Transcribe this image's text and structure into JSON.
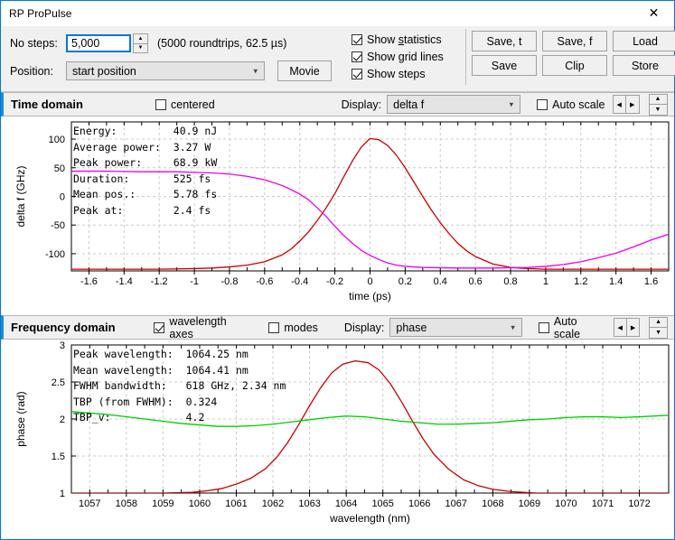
{
  "window": {
    "title": "RP ProPulse",
    "close_icon": "close-icon"
  },
  "controls": {
    "no_steps_label": "No steps:",
    "no_steps_value": "5,000",
    "roundtrips_hint": "(5000 roundtrips, 62.5 µs)",
    "position_label": "Position:",
    "position_value": "start position",
    "movie_button": "Movie",
    "checkboxes": [
      {
        "label_pre": "Show ",
        "label_accel": "s",
        "label_post": "tatistics",
        "checked": true,
        "name": "show-statistics"
      },
      {
        "label_pre": "Show ",
        "label_accel": "g",
        "label_post": "rid lines",
        "checked": true,
        "name": "show-grid-lines"
      },
      {
        "label_pre": "Show steps",
        "label_accel": "",
        "label_post": "",
        "checked": true,
        "name": "show-steps"
      }
    ],
    "buttons": [
      "Save, t",
      "Save, f",
      "Load",
      "Save",
      "Clip",
      "Store"
    ]
  },
  "time_domain": {
    "title": "Time domain",
    "centered_label": "centered",
    "centered_checked": false,
    "display_label": "Display:",
    "display_value": "delta f",
    "autoscale_label": "Auto scale",
    "autoscale_checked": false,
    "stats": [
      {
        "key": "Energy:",
        "value": "40.9 nJ"
      },
      {
        "key": "Average power:",
        "value": "3.27 W"
      },
      {
        "key": "Peak power:",
        "value": "68.9 kW"
      },
      {
        "key": "Duration:",
        "value": "525 fs"
      },
      {
        "key": "Mean pos.:",
        "value": "5.78 fs"
      },
      {
        "key": "Peak at:",
        "value": "2.4 fs"
      }
    ]
  },
  "frequency_domain": {
    "title": "Frequency domain",
    "wavelength_axes_label": "wavelength axes",
    "wavelength_axes_checked": true,
    "modes_label": "modes",
    "modes_checked": false,
    "display_label": "Display:",
    "display_value": "phase",
    "autoscale_label": "Auto scale",
    "autoscale_checked": false,
    "stats": [
      {
        "key": "Peak wavelength:",
        "value": "1064.25 nm"
      },
      {
        "key": "Mean wavelength:",
        "value": "1064.41 nm"
      },
      {
        "key": "FWHM bandwidth:",
        "value": "618 GHz, 2.34 nm"
      },
      {
        "key": "TBP (from FWHM):",
        "value": "0.324"
      },
      {
        "key": "TBP_v:",
        "value": "4.2"
      }
    ]
  },
  "colors": {
    "accent": "#1f8ad2",
    "pulse_red": "#cc0000",
    "chirp_magenta": "#ee00ee",
    "phase_green": "#00cc00",
    "grid": "#cccccc",
    "panel": "#f0f0f0"
  },
  "chart_data": [
    {
      "type": "line",
      "id": "time-domain-plot",
      "title": "",
      "xlabel": "time (ps)",
      "ylabel": "delta f (GHz)",
      "xlim": [
        -1.7,
        1.7
      ],
      "ylim": [
        -130,
        130
      ],
      "xticks": [
        -1.6,
        -1.4,
        -1.2,
        -1,
        -0.8,
        -0.6,
        -0.4,
        -0.2,
        0,
        0.2,
        0.4,
        0.6,
        0.8,
        1,
        1.2,
        1.4,
        1.6
      ],
      "yticks": [
        100,
        50,
        0,
        -50,
        -100
      ],
      "grid": true,
      "series": [
        {
          "name": "power (red pulse)",
          "color": "#cc0000",
          "x": [
            -1.7,
            -1.2,
            -1.0,
            -0.9,
            -0.8,
            -0.7,
            -0.6,
            -0.5,
            -0.45,
            -0.4,
            -0.35,
            -0.3,
            -0.25,
            -0.2,
            -0.15,
            -0.1,
            -0.05,
            0.0,
            0.05,
            0.1,
            0.15,
            0.2,
            0.25,
            0.3,
            0.35,
            0.4,
            0.45,
            0.5,
            0.55,
            0.6,
            0.7,
            0.8,
            0.9,
            1.0,
            1.3,
            1.7
          ],
          "y": [
            -127,
            -127,
            -126,
            -125,
            -123,
            -120,
            -114,
            -102,
            -92,
            -78,
            -62,
            -42,
            -20,
            5,
            34,
            62,
            86,
            101,
            99,
            89,
            72,
            50,
            25,
            0,
            -24,
            -46,
            -65,
            -82,
            -95,
            -105,
            -118,
            -124,
            -126,
            -127,
            -127,
            -127
          ]
        },
        {
          "name": "instantaneous frequency (magenta chirp)",
          "color": "#ee00ee",
          "x": [
            -1.7,
            -1.5,
            -1.3,
            -1.1,
            -1.0,
            -0.9,
            -0.8,
            -0.7,
            -0.6,
            -0.5,
            -0.45,
            -0.4,
            -0.35,
            -0.3,
            -0.25,
            -0.2,
            -0.15,
            -0.1,
            -0.05,
            0.0,
            0.05,
            0.1,
            0.15,
            0.2,
            0.3,
            0.5,
            0.7,
            0.9,
            1.0,
            1.1,
            1.2,
            1.3,
            1.4,
            1.5,
            1.6,
            1.7
          ],
          "y": [
            44,
            44,
            43,
            43,
            42,
            41,
            39,
            35,
            29,
            19,
            12,
            4,
            -6,
            -20,
            -35,
            -52,
            -68,
            -82,
            -94,
            -103,
            -110,
            -116,
            -120,
            -122,
            -124,
            -125,
            -125,
            -124,
            -122,
            -119,
            -114,
            -107,
            -99,
            -88,
            -76,
            -66
          ]
        }
      ]
    },
    {
      "type": "line",
      "id": "frequency-domain-plot",
      "title": "",
      "xlabel": "wavelength (nm)",
      "ylabel": "phase (rad)",
      "xlim": [
        1056.5,
        1072.8
      ],
      "ylim": [
        1.0,
        3.0
      ],
      "xticks": [
        1057,
        1058,
        1059,
        1060,
        1061,
        1062,
        1063,
        1064,
        1065,
        1066,
        1067,
        1068,
        1069,
        1070,
        1071,
        1072
      ],
      "yticks": [
        3,
        2.5,
        2,
        1.5,
        1
      ],
      "grid": true,
      "series": [
        {
          "name": "spectrum (red)",
          "color": "#cc0000",
          "x": [
            1056.5,
            1059.0,
            1059.8,
            1060.2,
            1060.6,
            1061.0,
            1061.4,
            1061.8,
            1062.1,
            1062.4,
            1062.7,
            1063.0,
            1063.3,
            1063.6,
            1063.9,
            1064.25,
            1064.6,
            1064.9,
            1065.2,
            1065.5,
            1065.8,
            1066.1,
            1066.4,
            1066.8,
            1067.2,
            1067.6,
            1068.0,
            1068.5,
            1069.2,
            1070.5,
            1072.8
          ],
          "y": [
            1.0,
            1.0,
            1.01,
            1.03,
            1.06,
            1.12,
            1.2,
            1.33,
            1.48,
            1.68,
            1.92,
            2.18,
            2.42,
            2.62,
            2.74,
            2.785,
            2.76,
            2.66,
            2.48,
            2.24,
            1.98,
            1.73,
            1.52,
            1.32,
            1.18,
            1.1,
            1.05,
            1.02,
            1.0,
            1.0,
            1.0
          ]
        },
        {
          "name": "phase (green)",
          "color": "#00cc00",
          "x": [
            1056.5,
            1057.0,
            1057.5,
            1058.0,
            1058.5,
            1059.0,
            1059.5,
            1060.0,
            1060.5,
            1061.0,
            1061.5,
            1062.0,
            1062.5,
            1063.0,
            1063.5,
            1064.0,
            1064.5,
            1065.0,
            1065.5,
            1066.0,
            1066.5,
            1067.0,
            1067.5,
            1068.0,
            1068.5,
            1069.0,
            1069.5,
            1070.0,
            1070.5,
            1071.0,
            1071.5,
            1072.0,
            1072.8
          ],
          "y": [
            2.1,
            2.08,
            2.06,
            2.03,
            2.0,
            1.97,
            1.94,
            1.92,
            1.9,
            1.9,
            1.91,
            1.93,
            1.96,
            1.99,
            2.02,
            2.04,
            2.03,
            2.0,
            1.97,
            1.95,
            1.93,
            1.93,
            1.94,
            1.95,
            1.97,
            1.99,
            2.0,
            2.02,
            2.03,
            2.03,
            2.02,
            2.03,
            2.05
          ]
        }
      ]
    }
  ]
}
